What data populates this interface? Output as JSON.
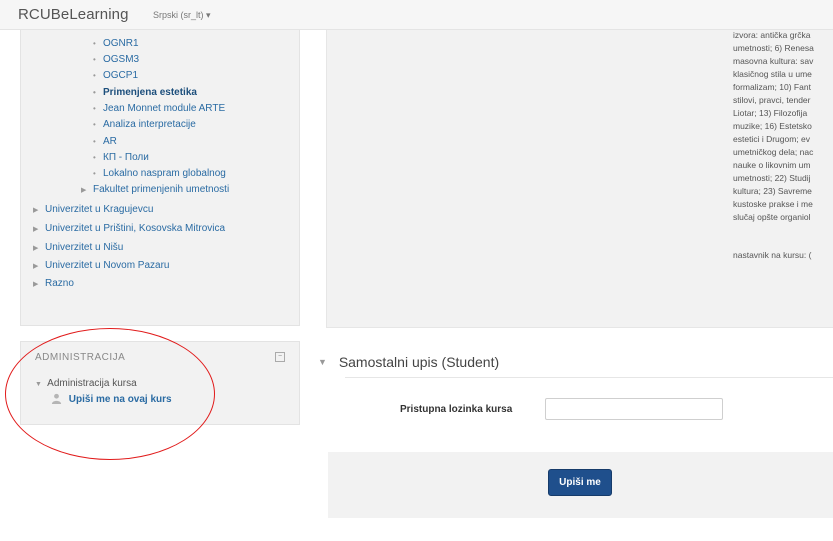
{
  "navbar": {
    "brand": "RCUBeLearning",
    "language": "Srpski (sr_lt) ▾"
  },
  "nav_tree": {
    "items": [
      {
        "label": "OGNR1",
        "type": "bullet",
        "active": false
      },
      {
        "label": "OGSM3",
        "type": "bullet",
        "active": false
      },
      {
        "label": "OGCP1",
        "type": "bullet",
        "active": false
      },
      {
        "label": "Primenjena estetika",
        "type": "bullet",
        "active": true
      },
      {
        "label": "Jean Monnet module ARTE",
        "type": "bullet",
        "active": false
      },
      {
        "label": "Analiza interpretacije",
        "type": "bullet",
        "active": false
      },
      {
        "label": "AR",
        "type": "bullet",
        "active": false
      },
      {
        "label": "КП - Поли",
        "type": "bullet",
        "active": false
      },
      {
        "label": "Lokalno naspram globalnog",
        "type": "bullet",
        "active": false
      },
      {
        "label": "Fakultet primenjenih umetnosti",
        "type": "collapsed",
        "active": false
      },
      {
        "label": "Univerzitet u Kragujevcu",
        "type": "collapsed",
        "active": false
      },
      {
        "label": "Univerzitet u Prištini, Kosovska Mitrovica",
        "type": "collapsed",
        "active": false
      },
      {
        "label": "Univerzitet u Nišu",
        "type": "collapsed",
        "active": false
      },
      {
        "label": "Univerzitet u Novom Pazaru",
        "type": "collapsed",
        "active": false
      },
      {
        "label": "Razno",
        "type": "collapsed",
        "active": false
      }
    ]
  },
  "admin": {
    "title": "ADMINISTRACIJA",
    "toggle": "−",
    "course_admin": "Administracija kursa",
    "enrol_link": "Upiši me na ovaj kurs"
  },
  "summary": {
    "lines": [
      "izvora: antička grčka",
      "umetnosti; 6) Renesa",
      "masovna kultura: sav",
      "klasičnog stila u ume",
      "formalizam; 10) Fant",
      "stilovi, pravci, tender",
      "Liotar; 13) Filozofija",
      "muzike; 16) Estetsko",
      "estetici i Drugom; ev",
      "umetničkog dela; nac",
      "nauke o likovnim um",
      "umetnosti; 22) Studij",
      "kultura; 23) Savreme",
      "kustoske prakse i me",
      "slučaj opšte organiol",
      "nastavnik na kursu: ("
    ]
  },
  "enrol": {
    "header": "Samostalni upis (Student)",
    "password_label": "Pristupna lozinka kursa",
    "password_value": "",
    "submit_label": "Upiši me"
  },
  "colors": {
    "link": "#2a6ba3",
    "button": "#1f4f8c",
    "annotation_circle": "#e11b1b"
  }
}
